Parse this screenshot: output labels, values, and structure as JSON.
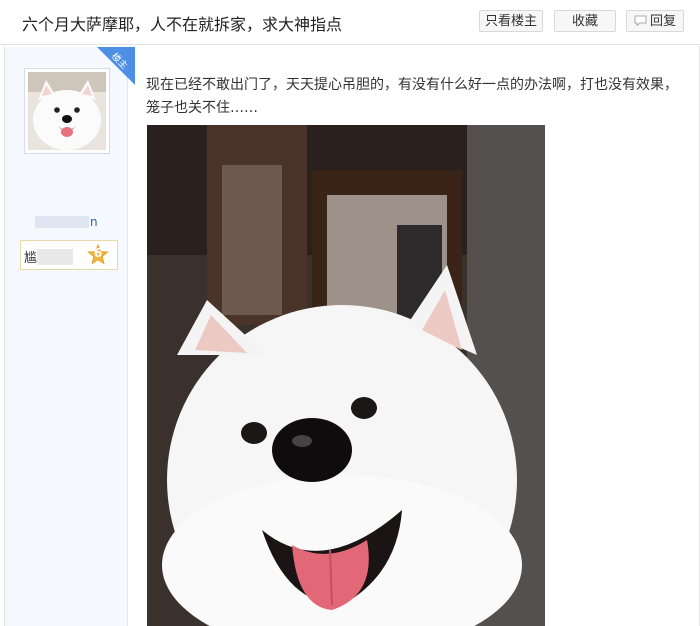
{
  "header": {
    "title": "六个月大萨摩耶，人不在就拆家，求大神指点",
    "only_op_label": "只看楼主",
    "favorite_label": "收藏",
    "reply_label": "回复"
  },
  "author": {
    "badge": "楼主",
    "name_suffix": "n",
    "level_prefix": "尴",
    "level": "6",
    "avatar_icon": "samoyed-avatar"
  },
  "post": {
    "text": "现在已经不敢出门了，天天提心吊胆的，有没有什么好一点的办法啊，打也没有效果，笼子也关不住……",
    "photo_icon": "samoyed-photo"
  },
  "colors": {
    "link": "#2d64b3",
    "badge": "#4e8fe6",
    "level_star": "#f4b33b",
    "sidebar": "#f5f8fc"
  }
}
